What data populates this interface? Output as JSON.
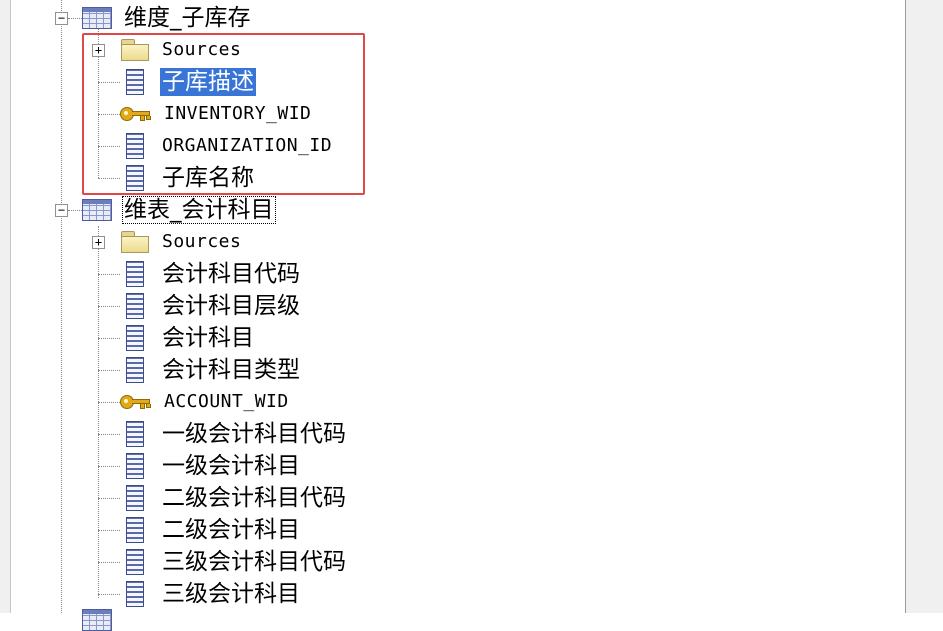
{
  "tree": {
    "table1": {
      "label": "维度_子库存",
      "expander": "−",
      "children": {
        "sources": "Sources",
        "sources_expander": "+",
        "col1": "子库描述",
        "col2": "INVENTORY_WID",
        "col3": "ORGANIZATION_ID",
        "col4": "子库名称"
      }
    },
    "table2": {
      "label": "维表_会计科目",
      "expander": "−",
      "children": {
        "sources": "Sources",
        "sources_expander": "+",
        "col1": "会计科目代码",
        "col2": "会计科目层级",
        "col3": "会计科目",
        "col4": "会计科目类型",
        "col5": "ACCOUNT_WID",
        "col6": "一级会计科目代码",
        "col7": "一级会计科目",
        "col8": "二级会计科目代码",
        "col9": "二级会计科目",
        "col10": "三级会计科目代码",
        "col11": "三级会计科目"
      }
    }
  },
  "colors": {
    "selection": "#3875d7",
    "highlight_box": "#e04848"
  }
}
